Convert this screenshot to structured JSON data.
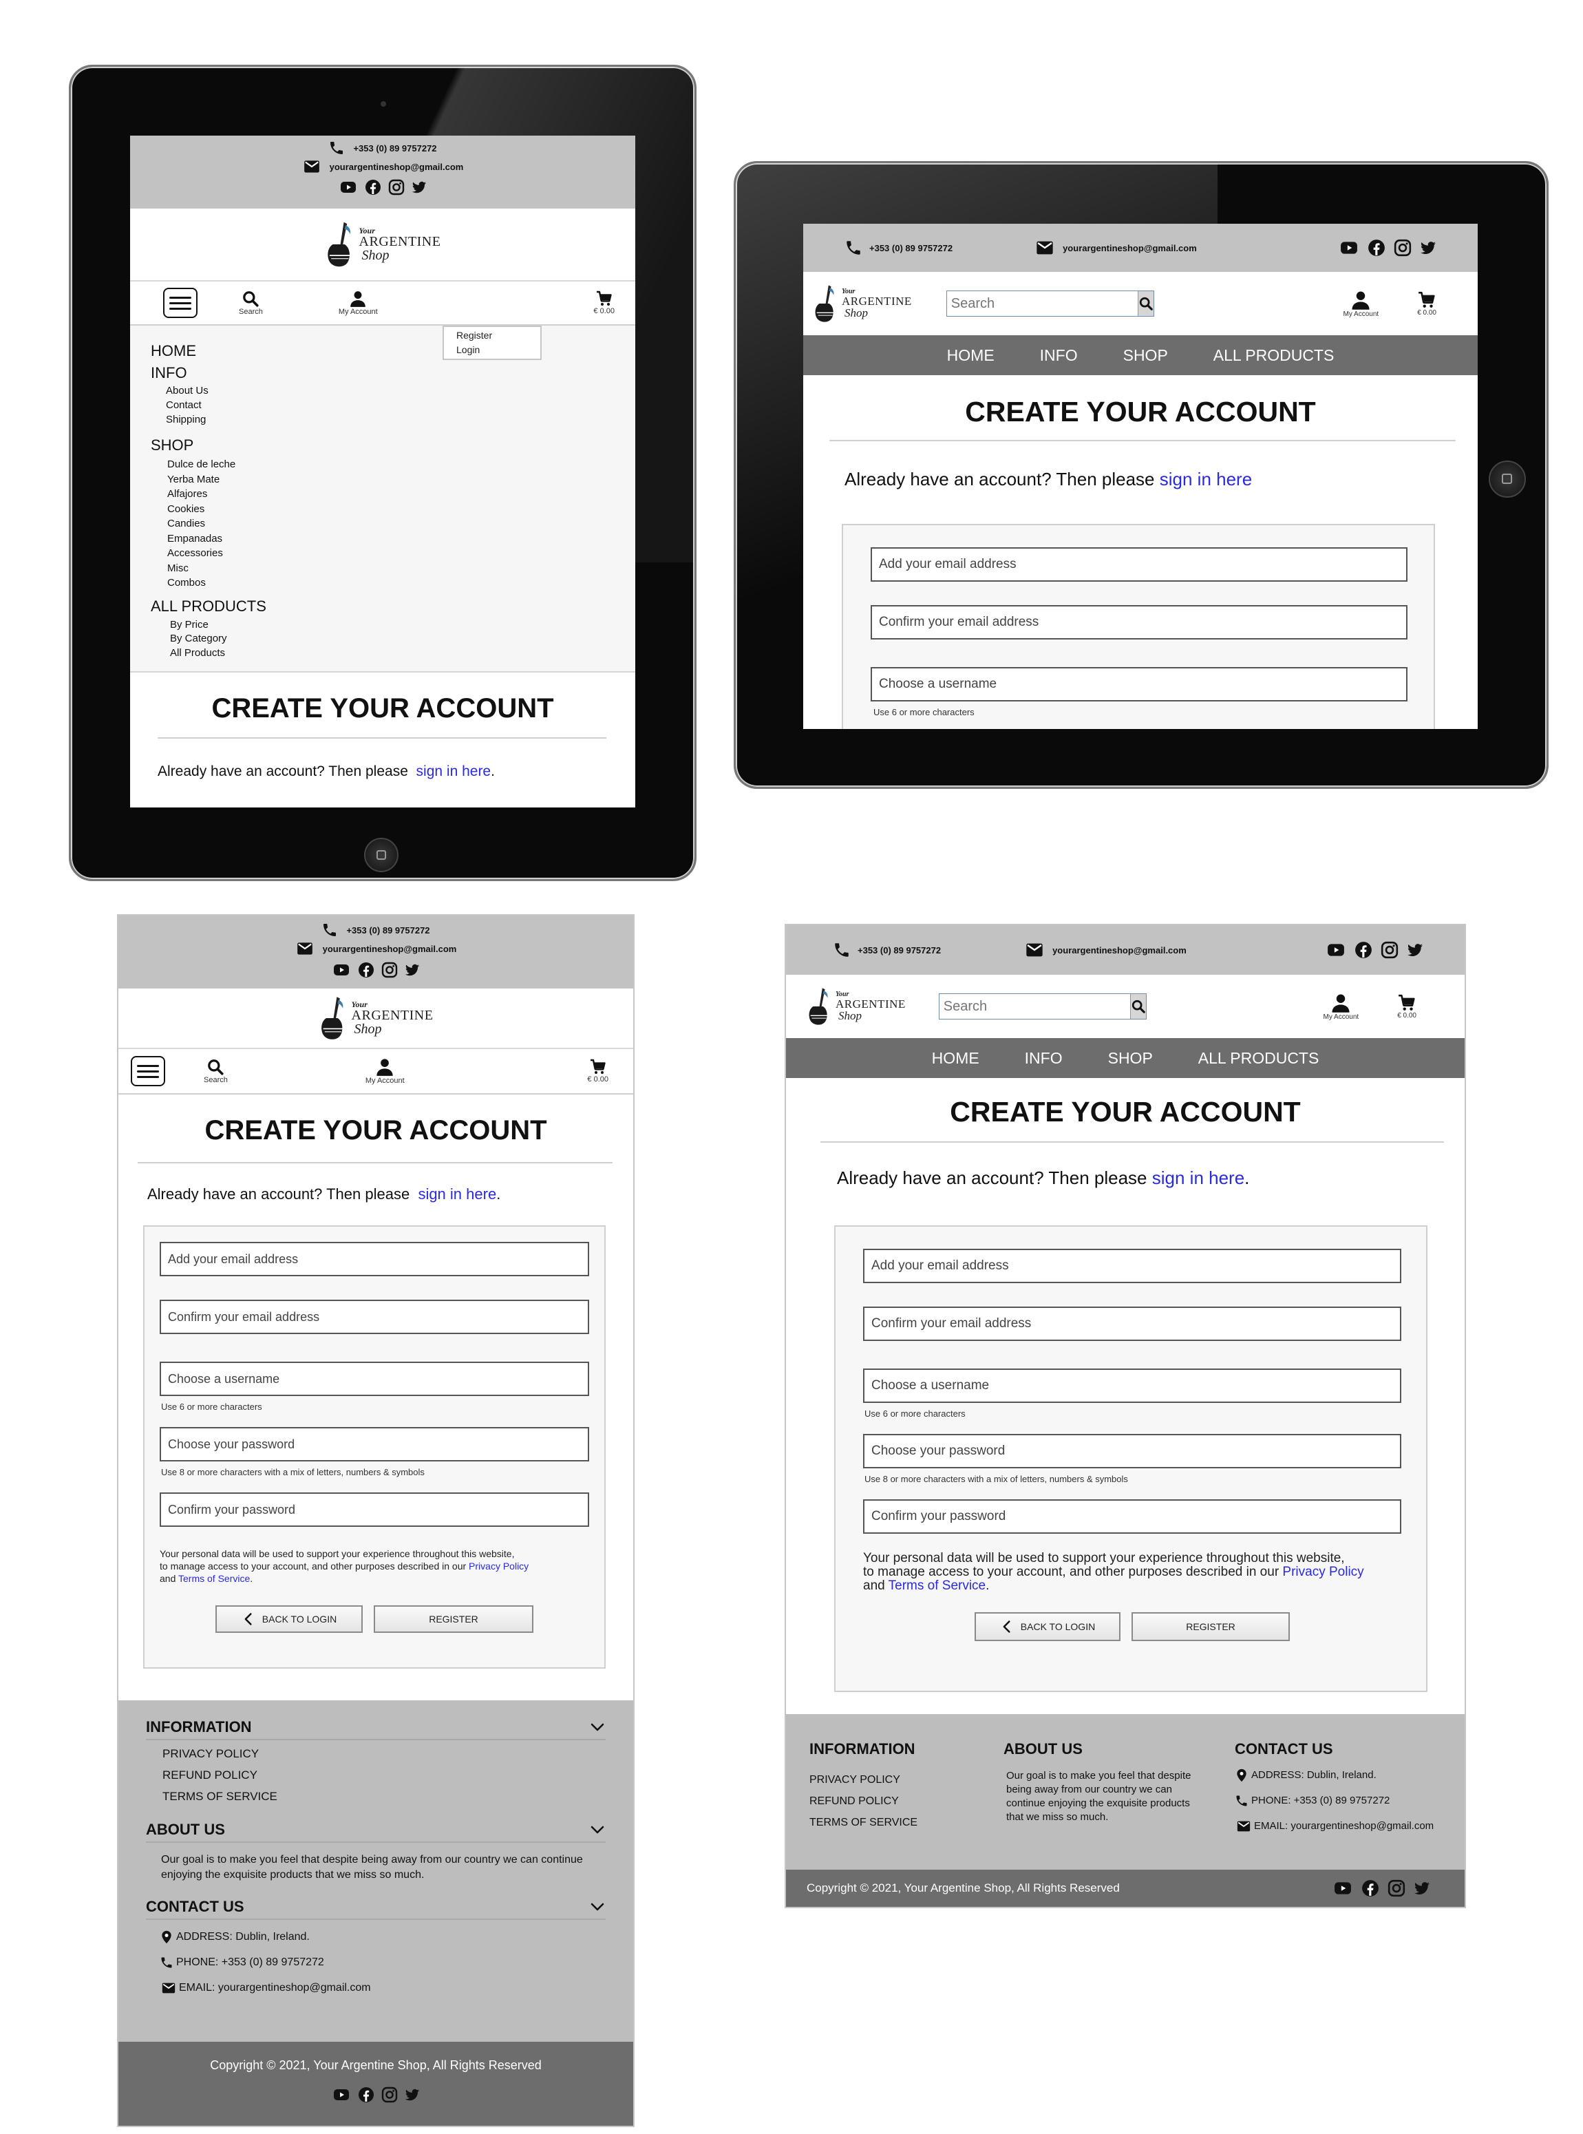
{
  "site": {
    "phone": "+353 (0) 89 9757272",
    "email": "yourargentineshop@gmail.com",
    "logo": {
      "line1": "Your",
      "line2": "ARGENTINE",
      "line3": "Shop"
    },
    "search_label": "Search",
    "search_placeholder": "Search",
    "account_label": "My Account",
    "cart_total": "€ 0.00",
    "social_icons": [
      "youtube-icon",
      "facebook-icon",
      "instagram-icon",
      "twitter-icon"
    ]
  },
  "nav": [
    "HOME",
    "INFO",
    "SHOP",
    "ALL PRODUCTS"
  ],
  "account_dropdown": [
    "Register",
    "Login"
  ],
  "side_menu": {
    "home": "HOME",
    "info": "INFO",
    "info_items": [
      "About Us",
      "Contact",
      "Shipping"
    ],
    "shop": "SHOP",
    "shop_items": [
      "Dulce de leche",
      "Yerba Mate",
      "Alfajores",
      "Cookies",
      "Candies",
      "Empanadas",
      "Accessories",
      "Misc",
      "Combos"
    ],
    "all_products": "ALL PRODUCTS",
    "all_items": [
      "By Price",
      "By Category",
      "All Products"
    ]
  },
  "page": {
    "title": "CREATE YOUR ACCOUNT",
    "signin_prefix": "Already have an account? Then please",
    "signin_link": "sign in here",
    "signin_suffix": "."
  },
  "form": {
    "email_placeholder": "Add your email address",
    "confirm_email_placeholder": "Confirm your email address",
    "username_placeholder": "Choose a username",
    "username_hint": "Use 6 or more characters",
    "password_placeholder": "Choose your password",
    "password_hint": "Use 8 or more characters with a mix of letters, numbers & symbols",
    "confirm_password_placeholder": "Confirm your password",
    "privacy_l1": "Your personal data will be used to support your experience throughout this website,",
    "privacy_l2": "to manage access to your account, and other purposes described in our",
    "privacy_link": "Privacy Policy",
    "privacy_and": "and",
    "terms_link": "Terms of Service",
    "terms_suffix": ".",
    "back_button": "BACK TO LOGIN",
    "register_button": "REGISTER"
  },
  "footer": {
    "information": "INFORMATION",
    "info_links": [
      "PRIVACY POLICY",
      "REFUND POLICY",
      "TERMS OF SERVICE"
    ],
    "about": "ABOUT US",
    "about_text": "Our goal is to make you feel that despite being away from our country we can continue enjoying the exquisite products that we miss so much.",
    "contact": "CONTACT US",
    "address": "ADDRESS: Dublin, Ireland.",
    "phone": "PHONE: +353 (0) 89 9757272",
    "email": "EMAIL: yourargentineshop@gmail.com",
    "copyright": "Copyright © 2021, Your Argentine Shop,  All Rights Reserved"
  }
}
